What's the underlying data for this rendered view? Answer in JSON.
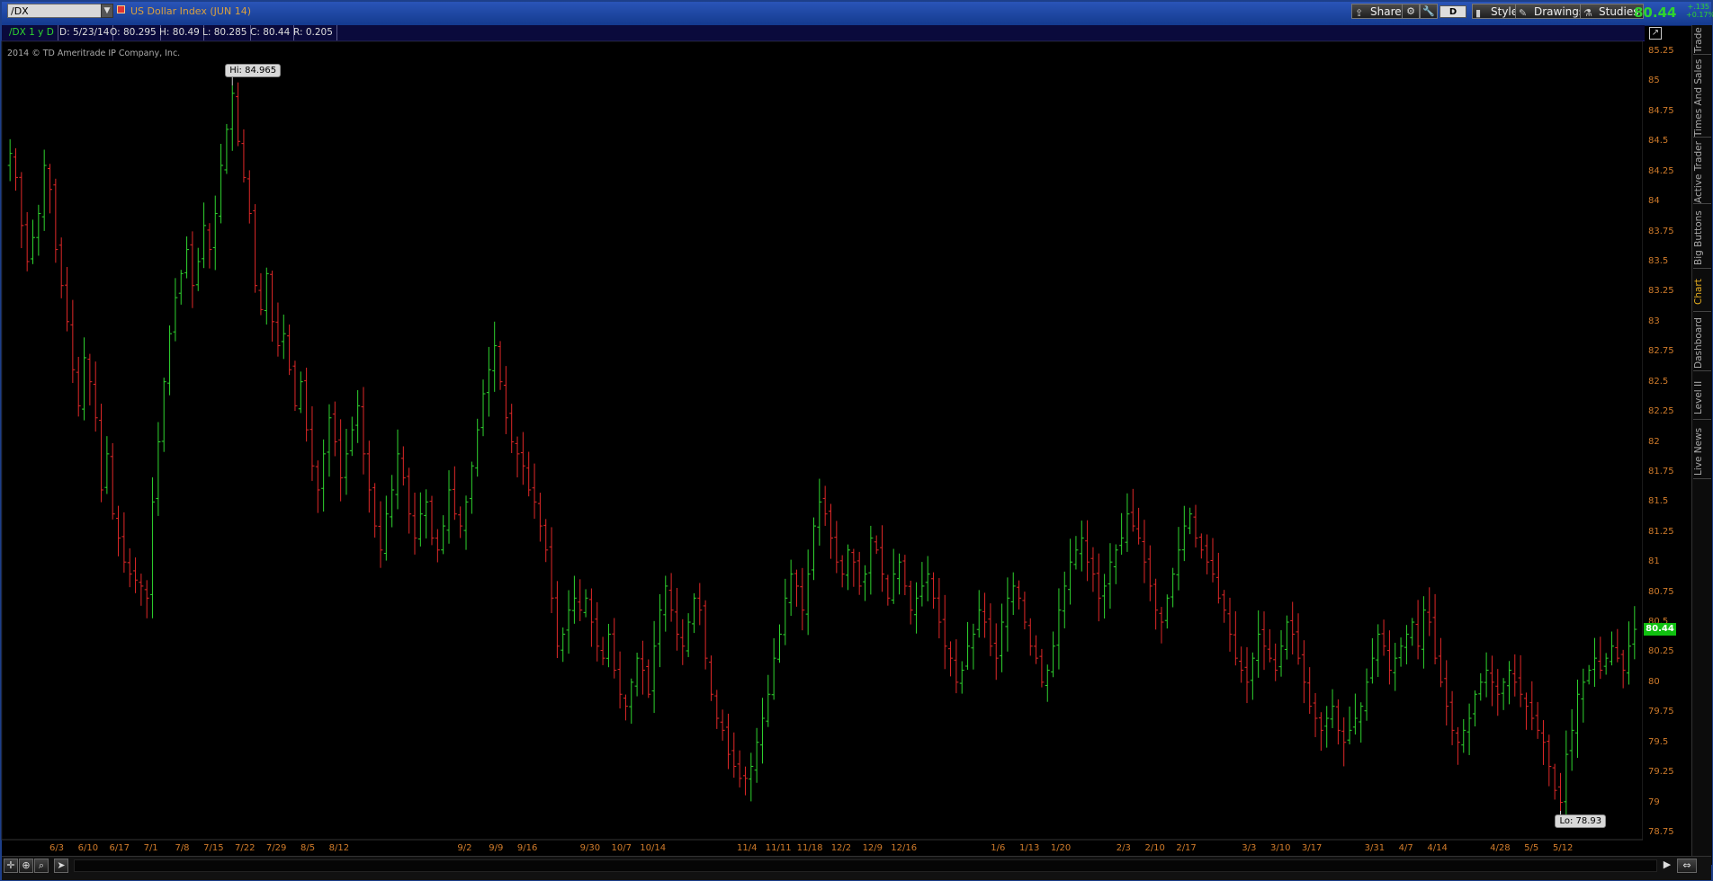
{
  "toolbar": {
    "symbol_value": "/DX",
    "symbol_description": "US Dollar Index (JUN 14)",
    "share_label": "Share",
    "aggregation_label": "D",
    "style_label": "Style",
    "drawings_label": "Drawings",
    "studies_label": "Studies",
    "last_price": "80.44",
    "change_abs": "+.135",
    "change_pct": "+0.17%"
  },
  "infobar": {
    "title": "/DX 1 y D",
    "date": "D: 5/23/14",
    "open": "O: 80.295",
    "high": "H: 80.49",
    "low": "L: 80.285",
    "close": "C: 80.44",
    "range": "R: 0.205"
  },
  "copyright": "2014 © TD Ameritrade IP Company, Inc.",
  "side_tabs": [
    "Trade",
    "Times And Sales",
    "Active Trader",
    "Big Buttons",
    "Chart",
    "Dashboard",
    "Level II",
    "Live News"
  ],
  "colors": {
    "up": "#2fd42f",
    "down": "#e02828",
    "axis": "#d07b2a",
    "background": "#000000"
  },
  "chart_data": {
    "type": "bar",
    "subtype": "ohlc",
    "ylim": [
      78.75,
      85.25
    ],
    "y_ticks": [
      "85.25",
      "85",
      "84.75",
      "84.5",
      "84.25",
      "84",
      "83.75",
      "83.5",
      "83.25",
      "83",
      "82.75",
      "82.5",
      "82.25",
      "82",
      "81.75",
      "81.5",
      "81.25",
      "81",
      "80.75",
      "80.5",
      "80.25",
      "80",
      "79.75",
      "79.5",
      "79.25",
      "79",
      "78.75"
    ],
    "x_tick_labels": [
      "6/3",
      "6/10",
      "6/17",
      "7/1",
      "7/8",
      "7/15",
      "7/22",
      "7/29",
      "8/5",
      "8/12",
      "9/2",
      "9/9",
      "9/16",
      "9/30",
      "10/7",
      "10/14",
      "11/4",
      "11/11",
      "11/18",
      "12/2",
      "12/9",
      "12/16",
      "1/6",
      "1/13",
      "1/20",
      "2/3",
      "2/10",
      "2/17",
      "3/3",
      "3/10",
      "3/17",
      "3/31",
      "4/7",
      "4/14",
      "4/28",
      "5/5",
      "5/12"
    ],
    "high_label": "Hi: 84.965",
    "low_label": "Lo: 78.93",
    "last_value_label": "80.44",
    "high": 84.965,
    "low": 78.93,
    "closes": [
      84.4,
      84.2,
      83.8,
      83.5,
      83.7,
      83.9,
      84.3,
      84.1,
      83.6,
      83.3,
      83.0,
      82.6,
      82.3,
      82.7,
      82.5,
      82.2,
      81.6,
      81.9,
      81.4,
      81.2,
      81.0,
      80.9,
      80.85,
      80.8,
      80.7,
      81.5,
      82.0,
      82.5,
      82.9,
      83.2,
      83.4,
      83.6,
      83.3,
      83.5,
      83.8,
      83.6,
      83.9,
      84.3,
      84.6,
      84.9,
      84.5,
      84.2,
      83.9,
      83.3,
      83.1,
      83.4,
      83.0,
      82.8,
      82.9,
      82.6,
      82.3,
      82.5,
      82.1,
      81.8,
      81.6,
      81.9,
      82.2,
      82.0,
      81.7,
      81.9,
      82.1,
      82.3,
      81.9,
      81.6,
      81.3,
      81.1,
      81.4,
      81.6,
      81.9,
      81.7,
      81.4,
      81.2,
      81.4,
      81.5,
      81.2,
      81.1,
      81.3,
      81.6,
      81.4,
      81.3,
      81.5,
      81.8,
      82.1,
      82.4,
      82.6,
      82.8,
      82.5,
      82.2,
      82.0,
      81.9,
      81.8,
      81.6,
      81.5,
      81.3,
      81.1,
      80.7,
      80.3,
      80.4,
      80.6,
      80.7,
      80.6,
      80.7,
      80.5,
      80.3,
      80.2,
      80.4,
      80.1,
      79.9,
      79.8,
      80.0,
      80.2,
      80.1,
      79.9,
      80.3,
      80.6,
      80.8,
      80.6,
      80.4,
      80.3,
      80.5,
      80.7,
      80.6,
      80.2,
      79.9,
      79.7,
      79.6,
      79.4,
      79.3,
      79.2,
      79.2,
      79.3,
      79.5,
      79.7,
      79.9,
      80.2,
      80.4,
      80.7,
      80.9,
      80.8,
      80.6,
      80.9,
      81.3,
      81.5,
      81.4,
      81.2,
      81.0,
      80.9,
      81.1,
      81.0,
      80.8,
      80.9,
      81.2,
      81.1,
      80.9,
      80.7,
      80.9,
      81.0,
      80.8,
      80.6,
      80.7,
      80.8,
      80.9,
      80.7,
      80.5,
      80.3,
      80.2,
      80.0,
      80.1,
      80.3,
      80.4,
      80.6,
      80.5,
      80.3,
      80.2,
      80.5,
      80.7,
      80.8,
      80.7,
      80.5,
      80.3,
      80.2,
      80.0,
      80.1,
      80.3,
      80.6,
      80.8,
      81.0,
      81.1,
      81.2,
      81.0,
      80.9,
      80.7,
      80.8,
      81.0,
      81.1,
      81.2,
      81.4,
      81.3,
      81.2,
      81.0,
      80.8,
      80.6,
      80.5,
      80.7,
      80.9,
      81.1,
      81.3,
      81.4,
      81.2,
      81.1,
      81.0,
      80.9,
      80.7,
      80.6,
      80.4,
      80.2,
      80.1,
      80.0,
      80.2,
      80.4,
      80.3,
      80.2,
      80.1,
      80.3,
      80.5,
      80.4,
      80.2,
      80.0,
      79.8,
      79.7,
      79.6,
      79.7,
      79.8,
      79.6,
      79.5,
      79.6,
      79.7,
      79.8,
      80.0,
      80.2,
      80.4,
      80.3,
      80.1,
      80.2,
      80.3,
      80.4,
      80.5,
      80.3,
      80.6,
      80.5,
      80.2,
      80.0,
      79.8,
      79.6,
      79.5,
      79.6,
      79.7,
      79.9,
      80.0,
      80.1,
      80.0,
      79.9,
      80.0,
      80.1,
      80.0,
      79.9,
      79.8,
      79.7,
      79.6,
      79.5,
      79.3,
      79.1,
      79.0,
      79.4,
      79.6,
      79.9,
      80.0,
      80.1,
      80.2,
      80.1,
      80.2,
      80.3,
      80.2,
      80.1,
      80.3,
      80.44
    ]
  }
}
